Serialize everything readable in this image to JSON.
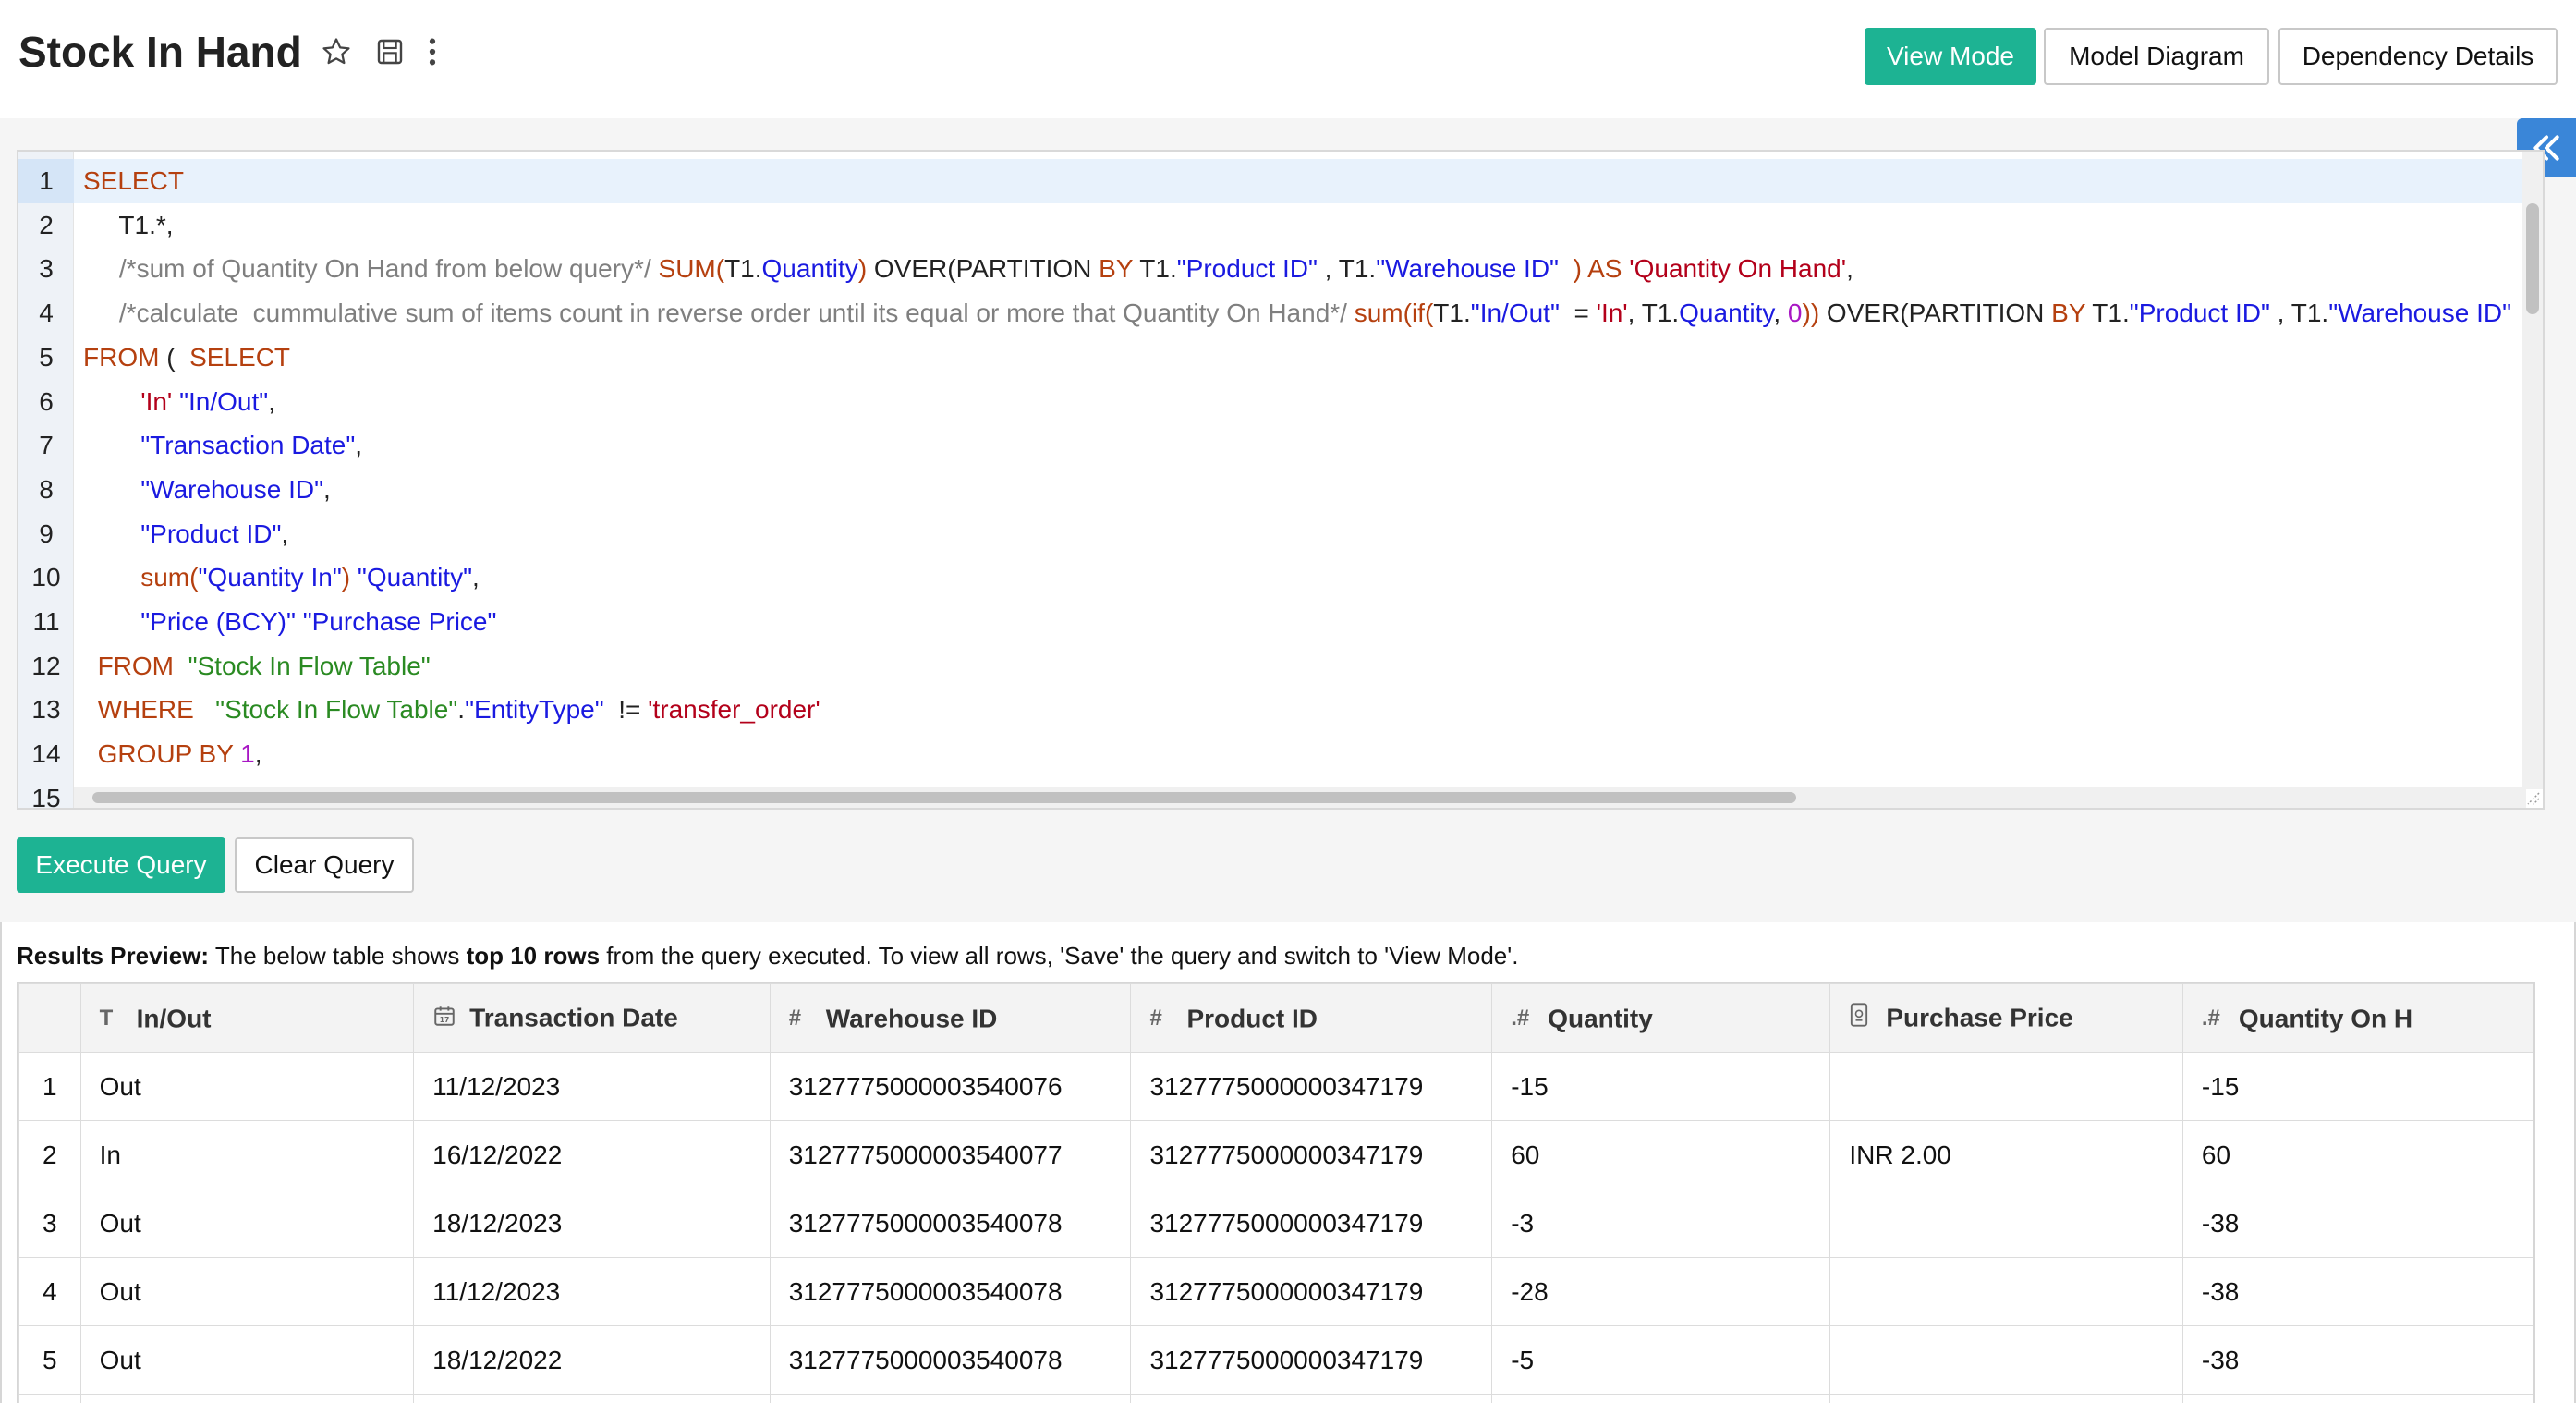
{
  "header": {
    "title": "Stock In Hand",
    "icons": [
      "star-icon",
      "save-icon",
      "more-vertical-icon"
    ],
    "buttons": {
      "view_mode": "View Mode",
      "model_diagram": "Model Diagram",
      "dependency_details": "Dependency Details"
    }
  },
  "editor": {
    "line_numbers": [
      "1",
      "2",
      "3",
      "4",
      "5",
      "6",
      "7",
      "8",
      "9",
      "10",
      "11",
      "12",
      "13",
      "14",
      "15"
    ],
    "collapse_icon": "double-chevron-left-icon"
  },
  "query_actions": {
    "execute": "Execute Query",
    "clear": "Clear Query"
  },
  "results": {
    "label": "Results Preview:",
    "text_1": " The below table shows ",
    "bold": "top 10 rows",
    "text_2": " from the query executed. To view all rows, 'Save' the query and switch to 'View Mode'.",
    "columns": [
      {
        "icon": "T",
        "label": "In/Out"
      },
      {
        "icon": "calendar-icon",
        "label": "Transaction Date"
      },
      {
        "icon": "#",
        "label": "Warehouse ID"
      },
      {
        "icon": "#",
        "label": "Product ID"
      },
      {
        "icon": ".#",
        "label": "Quantity"
      },
      {
        "icon": "currency-icon",
        "label": "Purchase Price"
      },
      {
        "icon": ".#",
        "label": "Quantity On H"
      }
    ],
    "rows": [
      {
        "n": "1",
        "cells": [
          "Out",
          "11/12/2023",
          "3127775000003540076",
          "3127775000000347179",
          "-15",
          "",
          "-15"
        ]
      },
      {
        "n": "2",
        "cells": [
          "In",
          "16/12/2022",
          "3127775000003540077",
          "3127775000000347179",
          "60",
          "INR 2.00",
          "60"
        ]
      },
      {
        "n": "3",
        "cells": [
          "Out",
          "18/12/2023",
          "3127775000003540078",
          "3127775000000347179",
          "-3",
          "",
          "-38"
        ]
      },
      {
        "n": "4",
        "cells": [
          "Out",
          "11/12/2023",
          "3127775000003540078",
          "3127775000000347179",
          "-28",
          "",
          "-38"
        ]
      },
      {
        "n": "5",
        "cells": [
          "Out",
          "18/12/2022",
          "3127775000003540078",
          "3127775000000347179",
          "-5",
          "",
          "-38"
        ]
      }
    ]
  },
  "colors": {
    "primary": "#1db393",
    "collapse": "#3a86d8",
    "keyword": "#b5400f",
    "identifier": "#1a1ae0",
    "string": "#b3001a",
    "table_name": "#2a8a22",
    "comment": "#7f7f7f",
    "number": "#a817c4"
  }
}
